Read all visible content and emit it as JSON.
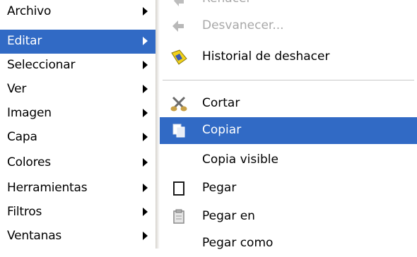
{
  "main_menu": {
    "items": [
      {
        "label": "Archivo"
      },
      {
        "label": "Editar"
      },
      {
        "label": "Seleccionar"
      },
      {
        "label": "Ver"
      },
      {
        "label": "Imagen"
      },
      {
        "label": "Capa"
      },
      {
        "label": "Colores"
      },
      {
        "label": "Herramientas"
      },
      {
        "label": "Filtros"
      },
      {
        "label": "Ventanas"
      }
    ]
  },
  "edit_submenu": {
    "items": [
      {
        "label": "Rehacer",
        "icon": "redo-icon"
      },
      {
        "label": "Desvanecer...",
        "icon": "fade-icon"
      },
      {
        "label": "Historial de deshacer",
        "icon": "undo-history-icon"
      },
      {
        "label": "Cortar",
        "icon": "cut-icon"
      },
      {
        "label": "Copiar",
        "icon": "copy-icon"
      },
      {
        "label": "Copia visible"
      },
      {
        "label": "Pegar",
        "icon": "paste-icon"
      },
      {
        "label": "Pegar en",
        "icon": "paste-into-icon"
      },
      {
        "label": "Pegar como"
      }
    ]
  },
  "colors": {
    "highlight": "#316ac5",
    "disabled_text": "#a8a8a8"
  }
}
